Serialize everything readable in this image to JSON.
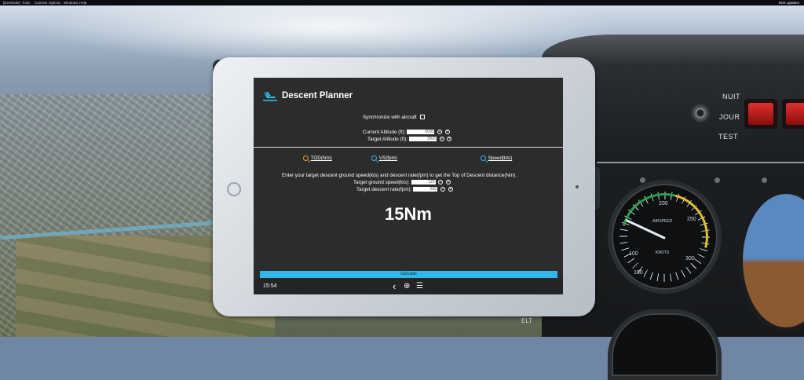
{
  "menubar": {
    "items": [
      "[DevMode]",
      "Tools",
      "Camera",
      "Options",
      "Windows",
      "Help"
    ],
    "update_text": "SDK updates"
  },
  "cockpit": {
    "labels": {
      "nuit": "NUIT",
      "jour": "JOUR",
      "test": "TEST"
    },
    "elt_label": "ELT",
    "airspeed_label": "AIRSPEED",
    "airspeed_unit": "KNOTS",
    "gauge_ticks": [
      "200",
      "250",
      "300",
      "100",
      "150"
    ]
  },
  "app": {
    "title": "Descent Planner",
    "sync_label": "Synchronize with aircraft",
    "current_altitude": {
      "label": "Current Altitude (ft):",
      "value": "5000"
    },
    "target_altitude": {
      "label": "Target Altitude (ft):",
      "value": "1500"
    },
    "tabs": [
      {
        "label": "TOD(Nm)",
        "color": "#f0a020"
      },
      {
        "label": "VS(fpm)",
        "color": "#33b7e8"
      },
      {
        "label": "Speed(kts)",
        "color": "#33b7e8"
      }
    ],
    "instructions": "Enter your target descent ground speed(kts) and descent rate(fpm) to get the Top of Descent distance(Nm).",
    "ground_speed": {
      "label": "Target ground speed(kts):",
      "value": "120"
    },
    "descent_rate": {
      "label": "Target descent rate(fpm):",
      "value": "500"
    },
    "result": "15Nm",
    "calculate_label": "Calculate",
    "clock": "15:54",
    "minus_symbol": "−",
    "plus_symbol": "+",
    "nav_icons": {
      "back": "‹",
      "globe": "⊕",
      "menu": "☰"
    }
  },
  "colors": {
    "accent": "#33b7e8",
    "active_tab": "#f0a020",
    "screen_bg": "#2b2c2e"
  }
}
